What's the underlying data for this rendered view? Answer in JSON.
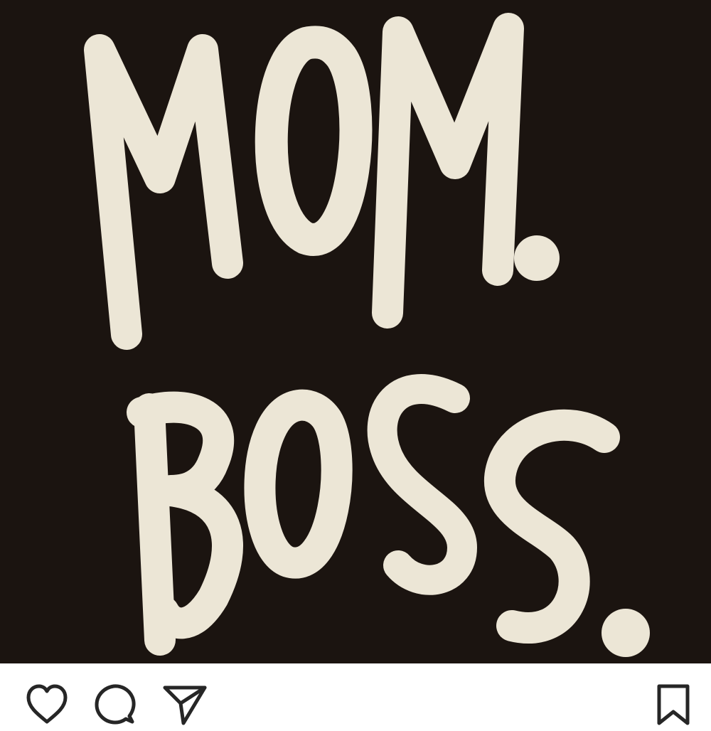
{
  "post": {
    "image": {
      "alt_text": "",
      "lettering": [
        "MOM.",
        "BOSS."
      ],
      "background_color": "#1b1410",
      "ink_color": "#ece6d6"
    }
  },
  "actions": {
    "like_icon": "heart-icon",
    "comment_icon": "comment-icon",
    "share_icon": "paper-plane-icon",
    "save_icon": "bookmark-icon",
    "icon_color": "#262626"
  }
}
